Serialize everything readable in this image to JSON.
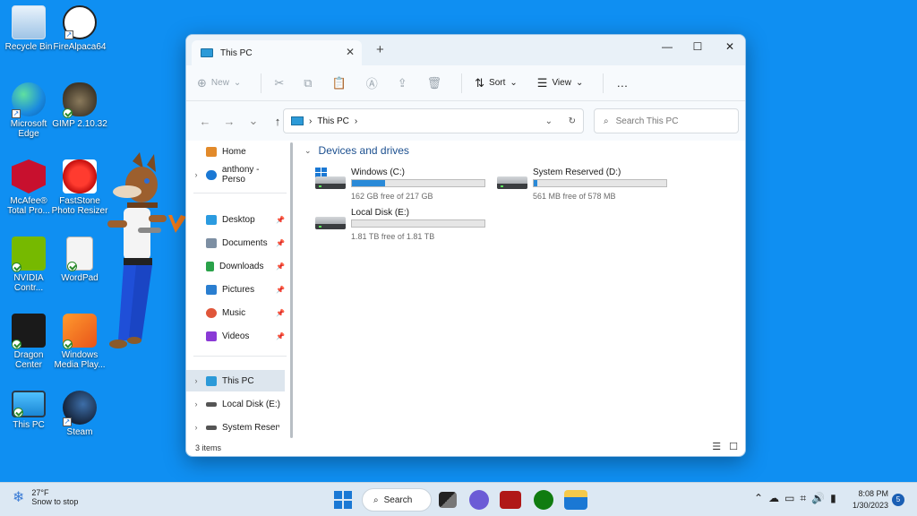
{
  "desktop": {
    "icons": [
      {
        "label": "Recycle Bin"
      },
      {
        "label": "FireAlpaca64"
      },
      {
        "label": "Microsoft Edge"
      },
      {
        "label": "GIMP 2.10.32"
      },
      {
        "label": "McAfee® Total Pro..."
      },
      {
        "label": "FastStone Photo Resizer"
      },
      {
        "label": "NVIDIA Contr..."
      },
      {
        "label": "WordPad"
      },
      {
        "label": "Dragon Center"
      },
      {
        "label": "Windows Media Play..."
      },
      {
        "label": "This PC"
      },
      {
        "label": "Steam"
      }
    ]
  },
  "window": {
    "tab_title": "This PC",
    "toolbar": {
      "new_label": "New",
      "sort_label": "Sort",
      "view_label": "View",
      "more_label": "…"
    },
    "address": {
      "path": "This PC",
      "search_placeholder": "Search This PC"
    },
    "nav": {
      "home": "Home",
      "onedrive": "anthony - Perso",
      "desktop": "Desktop",
      "documents": "Documents",
      "downloads": "Downloads",
      "pictures": "Pictures",
      "music": "Music",
      "videos": "Videos",
      "this_pc": "This PC",
      "local_disk": "Local Disk (E:)",
      "system_reserved": "System Reserved"
    },
    "group_title": "Devices and drives",
    "drives": [
      {
        "name": "Windows (C:)",
        "free_text": "162 GB free of 217 GB",
        "used_fraction": 0.25
      },
      {
        "name": "System Reserved (D:)",
        "free_text": "561 MB free of 578 MB",
        "used_fraction": 0.03
      },
      {
        "name": "Local Disk (E:)",
        "free_text": "1.81 TB free of 1.81 TB",
        "used_fraction": 0.0
      }
    ],
    "status": "3 items"
  },
  "taskbar": {
    "temp": "27°F",
    "weather_text": "Snow to stop",
    "search_label": "Search",
    "time": "8:08 PM",
    "date": "1/30/2023",
    "notifications": "5"
  },
  "colors": {
    "desktop_bg": "#0f8ff2",
    "accent": "#2a8ad8",
    "taskbar": "#dce8f3"
  }
}
